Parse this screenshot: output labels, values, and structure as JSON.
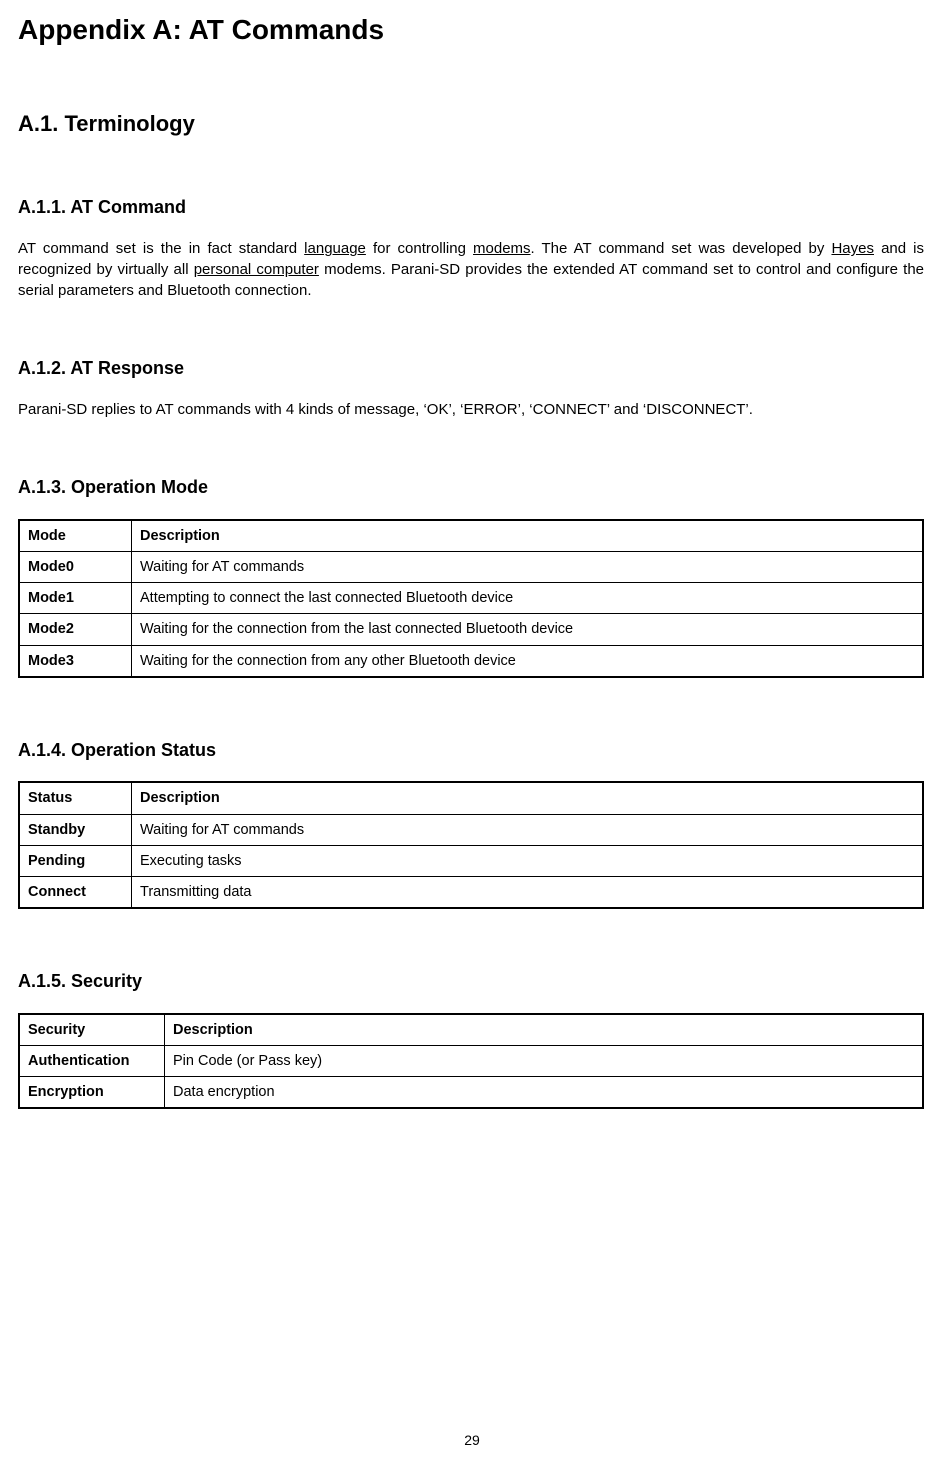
{
  "headings": {
    "title": "Appendix A: AT Commands",
    "h2_terminology": "A.1. Terminology",
    "h3_command": "A.1.1. AT Command",
    "h3_response": "A.1.2. AT Response",
    "h3_opmode": "A.1.3. Operation Mode",
    "h3_opstatus": "A.1.4. Operation Status",
    "h3_security": "A.1.5. Security"
  },
  "paragraphs": {
    "command_p1a": "AT command set is the in fact standard ",
    "command_link_language": "language",
    "command_p1b": " for controlling ",
    "command_link_modems": "modems",
    "command_p1c": ". The AT command set was developed by ",
    "command_link_hayes": "Hayes",
    "command_p1d": " and is recognized by virtually all ",
    "command_link_pc": "personal computer",
    "command_p1e": " modems. Parani-SD provides the extended AT command set to control and configure the serial parameters and Bluetooth connection.",
    "response_p1": "Parani-SD replies to AT commands with 4 kinds of message, ‘OK’, ‘ERROR’, ‘CONNECT’ and ‘DISCONNECT’."
  },
  "tables": {
    "mode": {
      "header": [
        "Mode",
        "Description"
      ],
      "rows": [
        [
          "Mode0",
          "Waiting for AT commands"
        ],
        [
          "Mode1",
          "Attempting to connect the last connected Bluetooth device"
        ],
        [
          "Mode2",
          "Waiting for the connection from the last connected Bluetooth device"
        ],
        [
          "Mode3",
          "Waiting for the connection from any other Bluetooth device"
        ]
      ]
    },
    "status": {
      "header": [
        "Status",
        "Description"
      ],
      "rows": [
        [
          "Standby",
          "Waiting for AT commands"
        ],
        [
          "Pending",
          "Executing tasks"
        ],
        [
          "Connect",
          "Transmitting data"
        ]
      ]
    },
    "security": {
      "header": [
        "Security",
        "Description"
      ],
      "rows": [
        [
          "Authentication",
          "Pin Code (or Pass key)"
        ],
        [
          "Encryption",
          "Data encryption"
        ]
      ]
    }
  },
  "page_number": "29"
}
